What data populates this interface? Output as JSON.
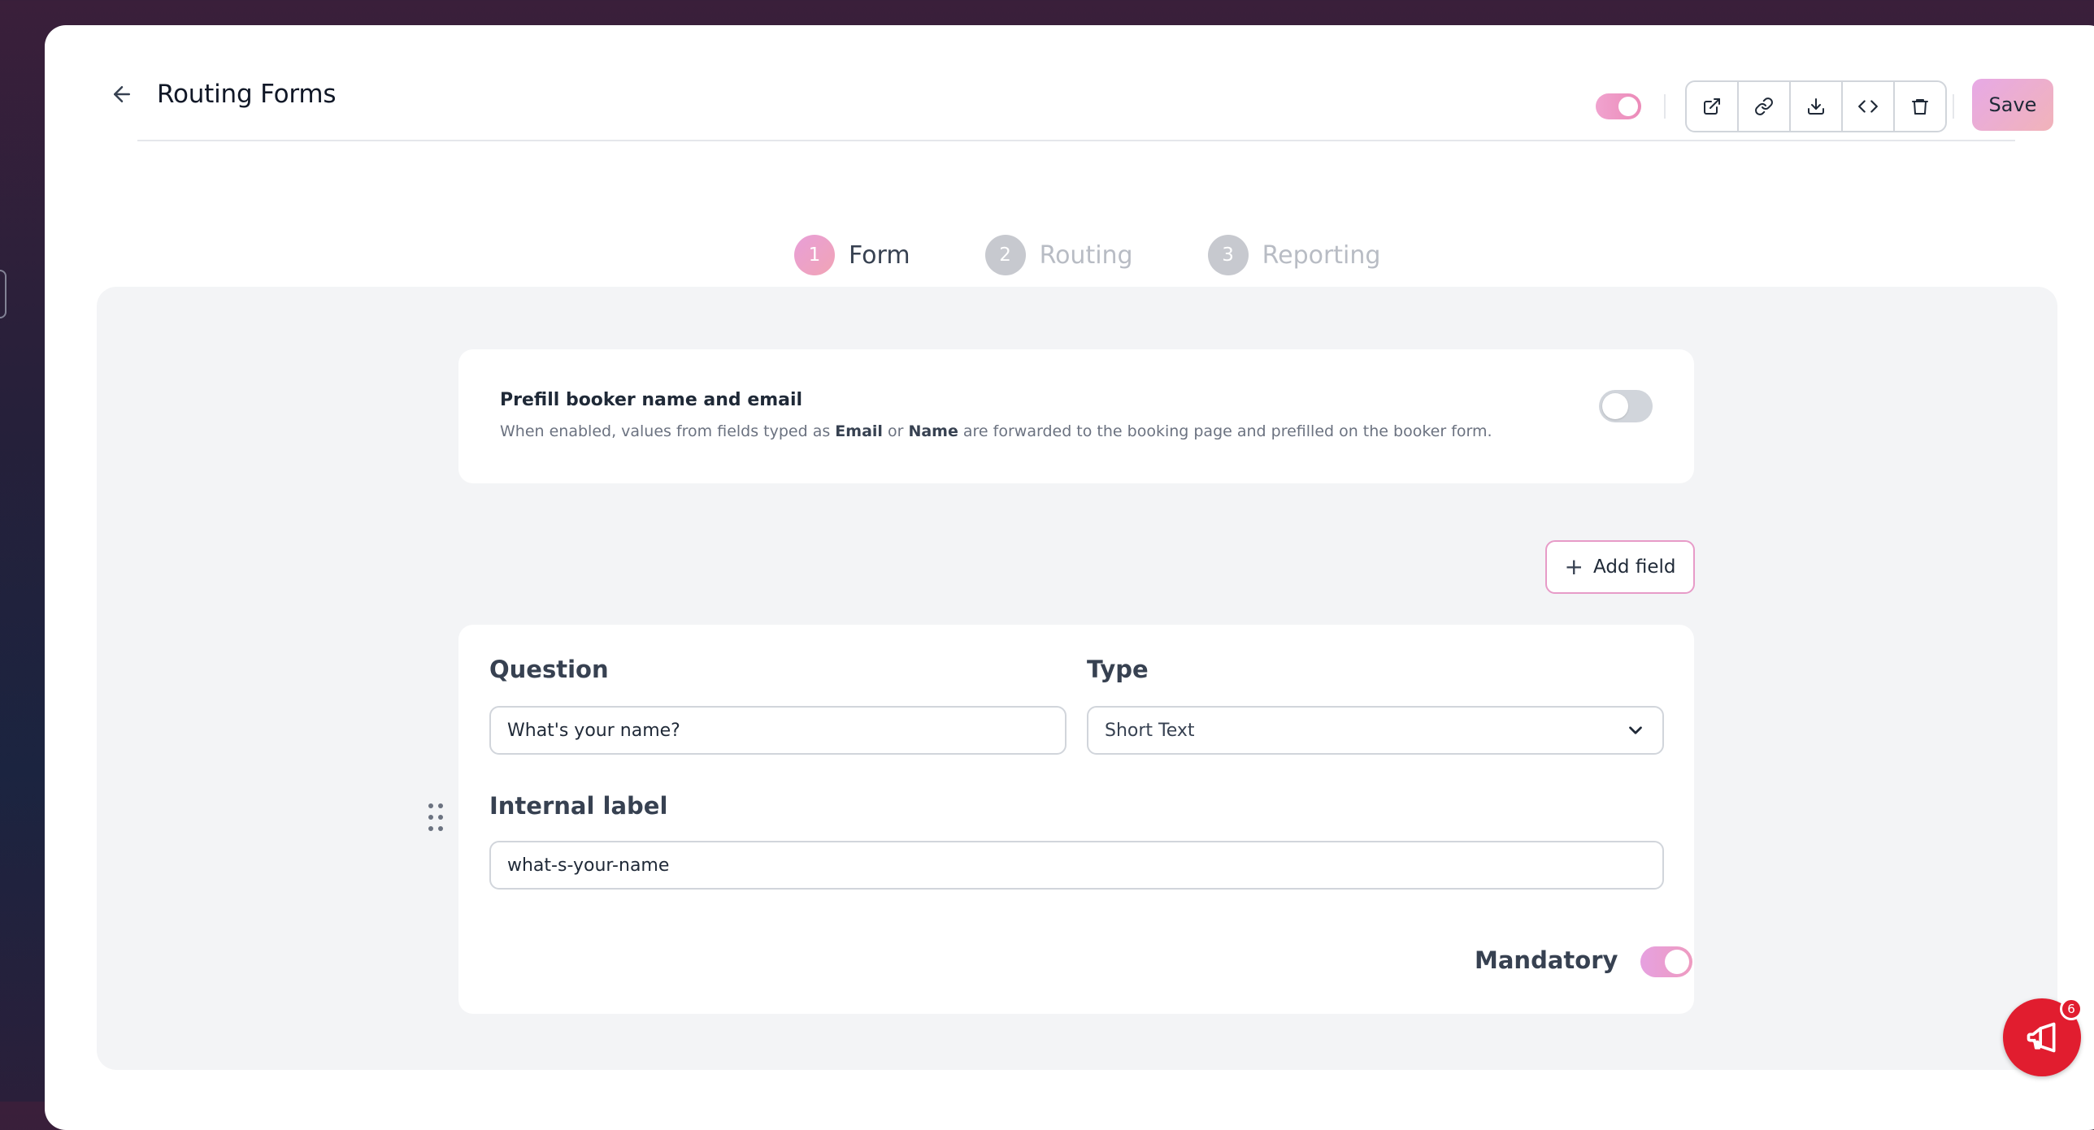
{
  "header": {
    "title": "Routing Forms",
    "toggle_on": true,
    "save_label": "Save",
    "icons": [
      "external-link-icon",
      "link-icon",
      "download-icon",
      "code-icon",
      "trash-icon"
    ]
  },
  "tabs": [
    {
      "num": "1",
      "label": "Form",
      "active": true
    },
    {
      "num": "2",
      "label": "Routing",
      "active": false
    },
    {
      "num": "3",
      "label": "Reporting",
      "active": false
    }
  ],
  "prefill": {
    "title": "Prefill booker name and email",
    "desc_before": "When enabled, values from fields typed as ",
    "email_word": "Email",
    "desc_or": " or ",
    "name_word": "Name",
    "desc_after": " are forwarded to the booking page and prefilled on the booker form.",
    "enabled": false
  },
  "add_field_label": "Add field",
  "field": {
    "question_label": "Question",
    "question_value": "What's your name?",
    "type_label": "Type",
    "type_value": "Short Text",
    "internal_label_label": "Internal label",
    "internal_label_value": "what-s-your-name",
    "mandatory_label": "Mandatory",
    "mandatory_on": true
  },
  "notifications": {
    "count": "6"
  },
  "colors": {
    "accent_pink": "#ec8bb8",
    "notif_red": "#e11d2f",
    "panel_bg": "#f3f4f6"
  }
}
